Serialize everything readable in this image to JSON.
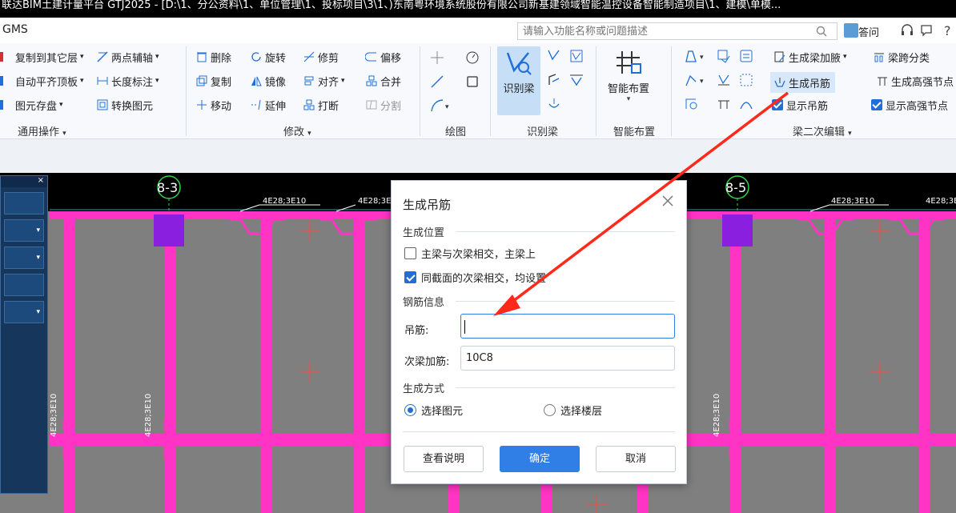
{
  "window": {
    "title": "联达BIM土建计量平台 GTJ2025 - [D:\\1、分公资料\\1、单位管理\\1、投标项目\\3\\1、)东南粤环境系统股份有限公司新基建领域智能温控设备智能制造项目\\1、建模\\单模..."
  },
  "menubar": {
    "app_name": "GMS",
    "search_placeholder": "请输入功能名称或问题描述",
    "qa_label": "答问"
  },
  "ribbon": {
    "general": {
      "copy_to_layer": "复制到其它层",
      "auto_align": "自动平齐顶板",
      "save_element": "图元存盘",
      "two_point_axis": "两点辅轴",
      "length_annotate": "长度标注",
      "convert_element": "转换图元",
      "group_label": "通用操作"
    },
    "modify": {
      "delete": "删除",
      "rotate": "旋转",
      "trim": "修剪",
      "offset": "偏移",
      "copy": "复制",
      "mirror": "镜像",
      "align": "对齐",
      "merge": "合并",
      "move": "移动",
      "extend": "延伸",
      "break": "打断",
      "split": "分割",
      "group_label": "修改"
    },
    "draw": {
      "group_label": "绘图"
    },
    "recognize": {
      "big_button": "识别梁",
      "group_label": "识别梁"
    },
    "smart": {
      "big_button": "智能布置",
      "group_label": "智能布置"
    },
    "beam_edit": {
      "gen_haunch": "生成梁加腋",
      "span_classify": "梁跨分类",
      "gen_hanger": "生成吊筋",
      "gen_hs_node": "生成高强节点",
      "show_hanger": "显示吊筋",
      "show_hs_node": "显示高强节点",
      "group_label": "梁二次编辑"
    }
  },
  "drawing": {
    "axis_left": "8-3",
    "axis_right": "8-5",
    "beam_labels": [
      "4E28;3E10",
      "4E28;3E10",
      "4E28;3E10",
      "4E28;3E"
    ],
    "vertical_label": "4E28;3E10"
  },
  "dialog": {
    "title": "生成吊筋",
    "position_section": "生成位置",
    "option_main_beam": "主梁与次梁相交，主梁上",
    "option_same_section": "同截面的次梁相交，均设置",
    "rebar_section": "钢筋信息",
    "hanger_label": "吊筋:",
    "hanger_value": "",
    "secondary_label": "次梁加筋:",
    "secondary_value": "10C8",
    "method_section": "生成方式",
    "radio_select_element": "选择图元",
    "radio_select_floor": "选择楼层",
    "btn_help": "查看说明",
    "btn_ok": "确定",
    "btn_cancel": "取消"
  },
  "colors": {
    "beam": "#ff33c4",
    "slab": "#7f7f7f",
    "accent": "#2f7fe6",
    "annotation": "#ff2a1a"
  }
}
